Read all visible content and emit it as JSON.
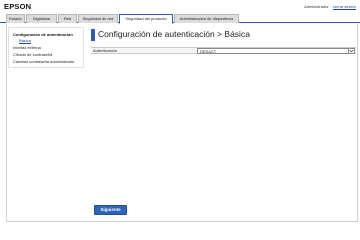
{
  "header": {
    "logo": "EPSON",
    "user": "Administrador",
    "logout": "cerrar sesión"
  },
  "tabs": [
    {
      "label": "Estado"
    },
    {
      "label": "Digitalizar"
    },
    {
      "label": "Red"
    },
    {
      "label": "Seguridad de red"
    },
    {
      "label": "Seguridad del producto"
    },
    {
      "label": "Administración de dispositivos"
    }
  ],
  "active_tab": "Seguridad del producto",
  "sidebar": {
    "items": [
      {
        "label": "Configuración de autenticación"
      },
      {
        "label": "Básica"
      },
      {
        "label": "Interfaz externa"
      },
      {
        "label": "Cifrado de contraseña"
      },
      {
        "label": "Cambiar contraseña administrador"
      }
    ]
  },
  "main": {
    "title": "Configuración de autenticación > Básica",
    "field_label": "Autenticación",
    "field_value": "DESACT",
    "next_button": "Siguiente"
  },
  "colors": {
    "accent": "#2b5fa8",
    "button": "#2f64b4",
    "link": "#1a49a8"
  }
}
